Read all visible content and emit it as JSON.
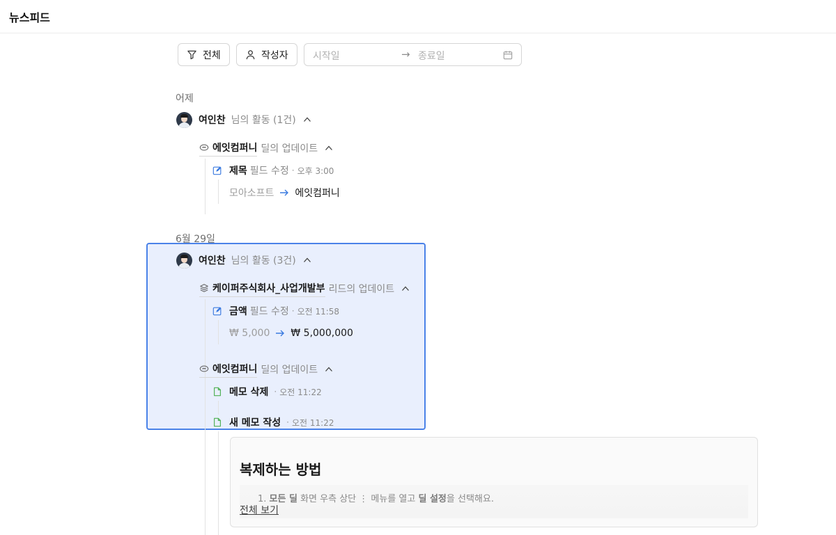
{
  "header": {
    "title": "뉴스피드"
  },
  "filters": {
    "all_label": "전체",
    "author_label": "작성자",
    "start_placeholder": "시작일",
    "arrow": "→",
    "end_placeholder": "종료일"
  },
  "groups": [
    {
      "date": "어제",
      "user": "여인찬",
      "summary": "님의 활동 (1건)",
      "entities": [
        {
          "name": "에잇컴퍼니",
          "suffix": "딜의 업데이트",
          "activities": [
            {
              "name": "제목",
              "suffix": "필드 수정",
              "time": "오후 3:00",
              "old": "모아소프트",
              "new": "에잇컴퍼니"
            }
          ]
        }
      ]
    },
    {
      "date": "6월 29일",
      "user": "여인찬",
      "summary": "님의 활동 (3건)",
      "entities": [
        {
          "name": "케이퍼주식회사_사업개발부",
          "suffix": "리드의 업데이트",
          "activities": [
            {
              "name": "금액",
              "suffix": "필드 수정",
              "time": "오전 11:58",
              "old": "₩ 5,000",
              "new": "₩ 5,000,000"
            }
          ]
        },
        {
          "name": "에잇컴퍼니",
          "suffix": "딜의 업데이트",
          "activities": [
            {
              "name": "메모 삭제",
              "time": "오전 11:22"
            },
            {
              "name": "새 메모 작성",
              "time": "오전 11:22"
            }
          ]
        }
      ]
    }
  ],
  "memo": {
    "title": "복제하는 방법",
    "line_prefix": "1.",
    "line_bold1": "모든 딜",
    "line_mid1": "화면 우측 상단",
    "line_kebab": "⋮",
    "line_mid2": "메뉴를 열고",
    "line_bold2": "딜 설정",
    "line_end": "을 선택해요.",
    "more_label": "전체 보기"
  },
  "separator": "·",
  "colors": {
    "accent": "#4a82e8",
    "memo_icon": "#4caf50",
    "edit_icon": "#3b7be0"
  }
}
